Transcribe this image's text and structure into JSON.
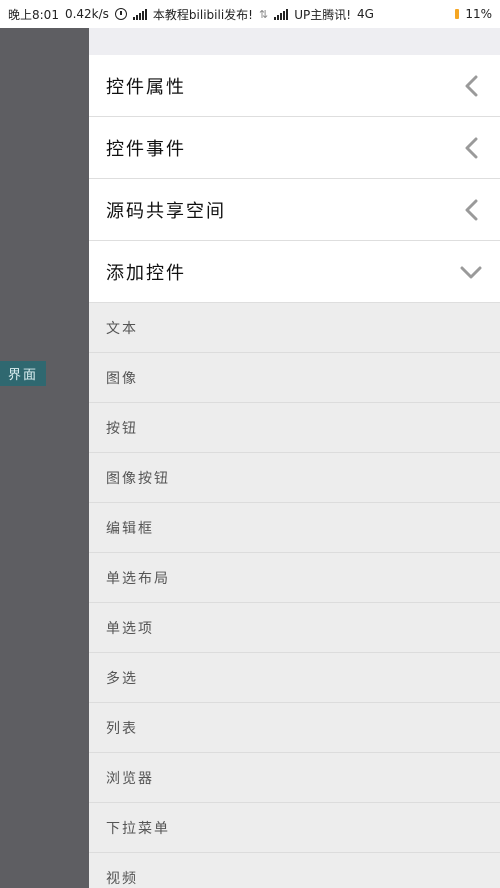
{
  "status_bar": {
    "time": "晚上8:01",
    "speed": "0.42k/s",
    "notif_1": "本教程bilibili发布!",
    "notif_2": "UP主腾讯!",
    "network": "4G",
    "battery": "11%"
  },
  "left_panel": {
    "tag": "界面"
  },
  "sections": [
    {
      "label": "控件属性",
      "state": "collapsed"
    },
    {
      "label": "控件事件",
      "state": "collapsed"
    },
    {
      "label": "源码共享空间",
      "state": "collapsed"
    },
    {
      "label": "添加控件",
      "state": "expanded"
    }
  ],
  "widgets": [
    {
      "label": "文本"
    },
    {
      "label": "图像"
    },
    {
      "label": "按钮"
    },
    {
      "label": "图像按钮"
    },
    {
      "label": "编辑框"
    },
    {
      "label": "单选布局"
    },
    {
      "label": "单选项"
    },
    {
      "label": "多选"
    },
    {
      "label": "列表"
    },
    {
      "label": "浏览器"
    },
    {
      "label": "下拉菜单"
    },
    {
      "label": "视频"
    }
  ],
  "colors": {
    "overlay": "#5e5e62",
    "tag_bg": "#2f6870",
    "section_bg": "#ffffff",
    "list_bg": "#ededed",
    "chevron": "#9a9a9a",
    "battery_accent": "#f5a623"
  },
  "icons": {
    "collapsed": "chevron-left-icon",
    "expanded": "chevron-down-icon"
  }
}
